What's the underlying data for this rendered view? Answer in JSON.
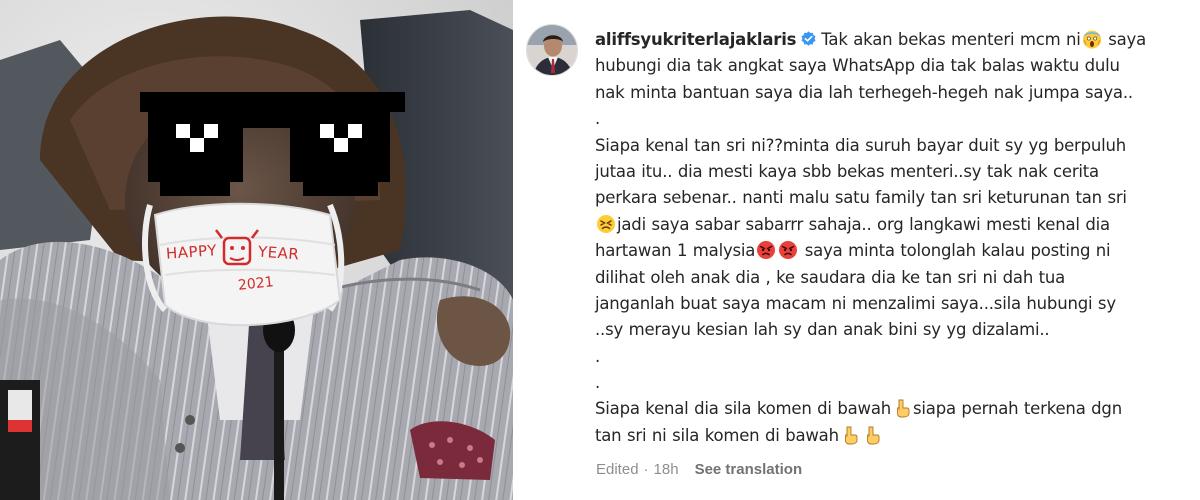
{
  "post": {
    "username": "aliffsyukriterlajaklaris",
    "verified": true,
    "caption_lines": [
      "Tak akan bekas menteri mcm ni",
      "saya",
      "hubungi dia tak angkat saya WhatsApp dia tak balas waktu dulu",
      "nak minta bantuan saya dia lah terhegeh-hegeh nak jumpa saya..",
      ".",
      "Siapa kenal tan sri ni??minta dia suruh bayar duit sy yg berpuluh",
      "jutaa itu.. dia mesti kaya sbb bekas menteri..sy tak nak cerita",
      "perkara sebenar.. nanti malu satu family tan sri keturunan tan sri",
      "jadi saya sabar sabarrr sahaja.. org langkawi mesti kenal dia",
      "hartawan 1 malysia",
      "saya minta tolonglah kalau posting ni",
      "dilihat oleh anak dia , ke saudara dia ke tan sri ni dah tua",
      "janganlah buat saya macam ni menzalimi saya...sila hubungi sy",
      "..sy merayu kesian lah sy dan anak bini sy yg dizalami..",
      ".",
      ".",
      "Siapa kenal dia sila komen di bawah",
      "siapa pernah terkena dgn",
      "tan sri ni sila komen di bawah"
    ],
    "edited_label": "Edited",
    "separator": "·",
    "time_ago": "18h",
    "see_translation": "See translation"
  },
  "photo": {
    "mask_text_1": "HAPPY",
    "mask_text_2": "YEAR",
    "mask_text_3": "2021"
  },
  "icons": {
    "verified": "verified-badge-icon",
    "emoji_scream": "face-screaming-icon",
    "emoji_persevere": "persevering-face-icon",
    "emoji_angry": "angry-face-icon",
    "emoji_point_down": "pointing-down-hand-icon"
  },
  "colors": {
    "text": "#262626",
    "meta": "#8e8e8e",
    "verified_blue": "#3897f0",
    "mask_text_red": "#d22b2b"
  }
}
